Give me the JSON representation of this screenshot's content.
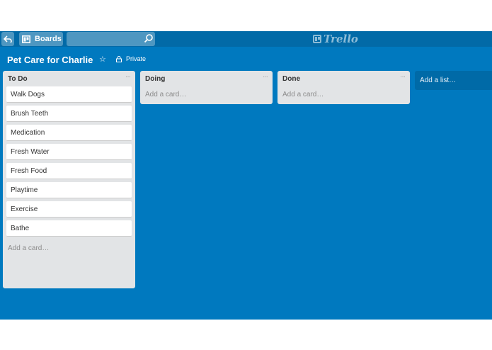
{
  "header": {
    "boards_label": "Boards",
    "logo_text": "Trello",
    "search_value": ""
  },
  "board": {
    "title": "Pet Care for Charlie",
    "visibility": "Private"
  },
  "lists": [
    {
      "title": "To Do",
      "menu": "···",
      "cards": [
        "Walk Dogs",
        "Brush Teeth",
        "Medication",
        "Fresh Water",
        "Fresh Food",
        "Playtime",
        "Exercise",
        "Bathe"
      ],
      "add_card": "Add a card…"
    },
    {
      "title": "Doing",
      "menu": "···",
      "cards": [],
      "add_card": "Add a card…"
    },
    {
      "title": "Done",
      "menu": "···",
      "cards": [],
      "add_card": "Add a card…"
    }
  ],
  "add_list": "Add a list…",
  "colors": {
    "board_bg": "#0079bf",
    "header_bg": "#026aa7",
    "list_bg": "#e2e4e6"
  }
}
